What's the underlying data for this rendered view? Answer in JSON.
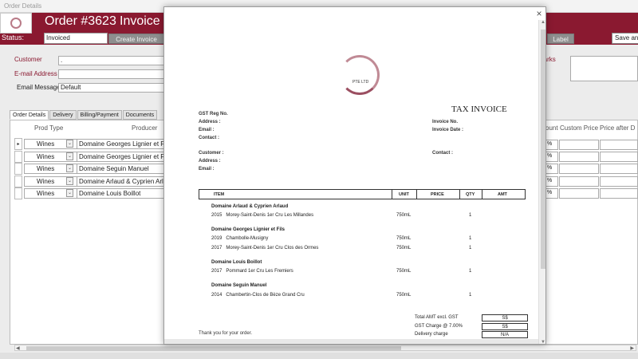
{
  "window": {
    "title": "Order Details"
  },
  "header": {
    "order_title": "Order #3623",
    "invoice_title": "Invoice #",
    "status_label": "Status:",
    "status_value": "Invoiced",
    "create_invoice_label": "Create Invoice",
    "label_button": "Label",
    "save_button": "Save an"
  },
  "customer": {
    "customer_label": "Customer",
    "customer_value": ".",
    "email_label": "E-mail Address",
    "email_message_label": "Email Message",
    "email_message_value": "Default",
    "remarks_label": "marks"
  },
  "tabs": [
    "Order Details",
    "Delivery",
    "Billing/Payment",
    "Documents"
  ],
  "grid": {
    "col_prod_type": "Prod Type",
    "col_producer": "Producer",
    "col_discount": "ount",
    "col_custom_price": "Custom Price",
    "col_price_after": "Price after D",
    "rows": [
      {
        "type": "Wines",
        "producer": "Domaine Georges Lignier et Fils",
        "pct": "%"
      },
      {
        "type": "Wines",
        "producer": "Domaine Georges Lignier et Fils",
        "pct": "%"
      },
      {
        "type": "Wines",
        "producer": "Domaine Seguin Manuel",
        "pct": "%"
      },
      {
        "type": "Wines",
        "producer": "Domaine Arlaud & Cyprien Arlaud",
        "pct": "%"
      },
      {
        "type": "Wines",
        "producer": "Domaine Louis Boillot",
        "pct": "%"
      }
    ]
  },
  "invoice": {
    "logo_text": "PTE LTD",
    "title": "TAX INVOICE",
    "gst_reg": "GST Reg No.",
    "address": "Address :",
    "email": "Email :",
    "contact": "Contact :",
    "invoice_no": "Invoice No.",
    "invoice_date": "Invoice Date :",
    "customer": "Customer :",
    "cust_address": "Address :",
    "cust_email": "Email :",
    "cust_contact": "Contact :",
    "col_item": "ITEM",
    "col_unit": "UNIT",
    "col_price": "PRICE",
    "col_qty": "QTY",
    "col_amt": "AMT",
    "groups": [
      {
        "producer": "Domaine Arlaud & Cyprien Arlaud",
        "lines": [
          {
            "year": "2015",
            "name": "Morey-Saint-Denis 1er Cru Les Millandes",
            "unit": "750mL",
            "qty": "1"
          }
        ]
      },
      {
        "producer": "Domaine Georges Lignier et Fils",
        "lines": [
          {
            "year": "2019",
            "name": "Chambolle-Musigny",
            "unit": "750mL",
            "qty": "1"
          },
          {
            "year": "2017",
            "name": "Morey-Saint-Denis 1er Cru Clos des Ormes",
            "unit": "750mL",
            "qty": "1"
          }
        ]
      },
      {
        "producer": "Domaine Louis Boillot",
        "lines": [
          {
            "year": "2017",
            "name": "Pommard 1er Cru Les Fremiers",
            "unit": "750mL",
            "qty": "1"
          }
        ]
      },
      {
        "producer": "Domaine Seguin Manuel",
        "lines": [
          {
            "year": "2014",
            "name": "Chambertin-Clos de Bèze Grand Cru",
            "unit": "750mL",
            "qty": "1"
          }
        ]
      }
    ],
    "total_label": "Total AMT excl. GST",
    "total_value": "S$",
    "gst_label": "GST Charge @ 7.00%",
    "gst_value": "S$",
    "delivery_label": "Delivery charge",
    "delivery_value": "N/A",
    "thanks": "Thank you for your order."
  },
  "colors": {
    "brand": "#8a1930",
    "button_gray": "#8e8e8e"
  },
  "icons": {
    "close": "close-icon",
    "dropdown": "chevron-down-icon",
    "record_selector": "record-selector-icon"
  }
}
